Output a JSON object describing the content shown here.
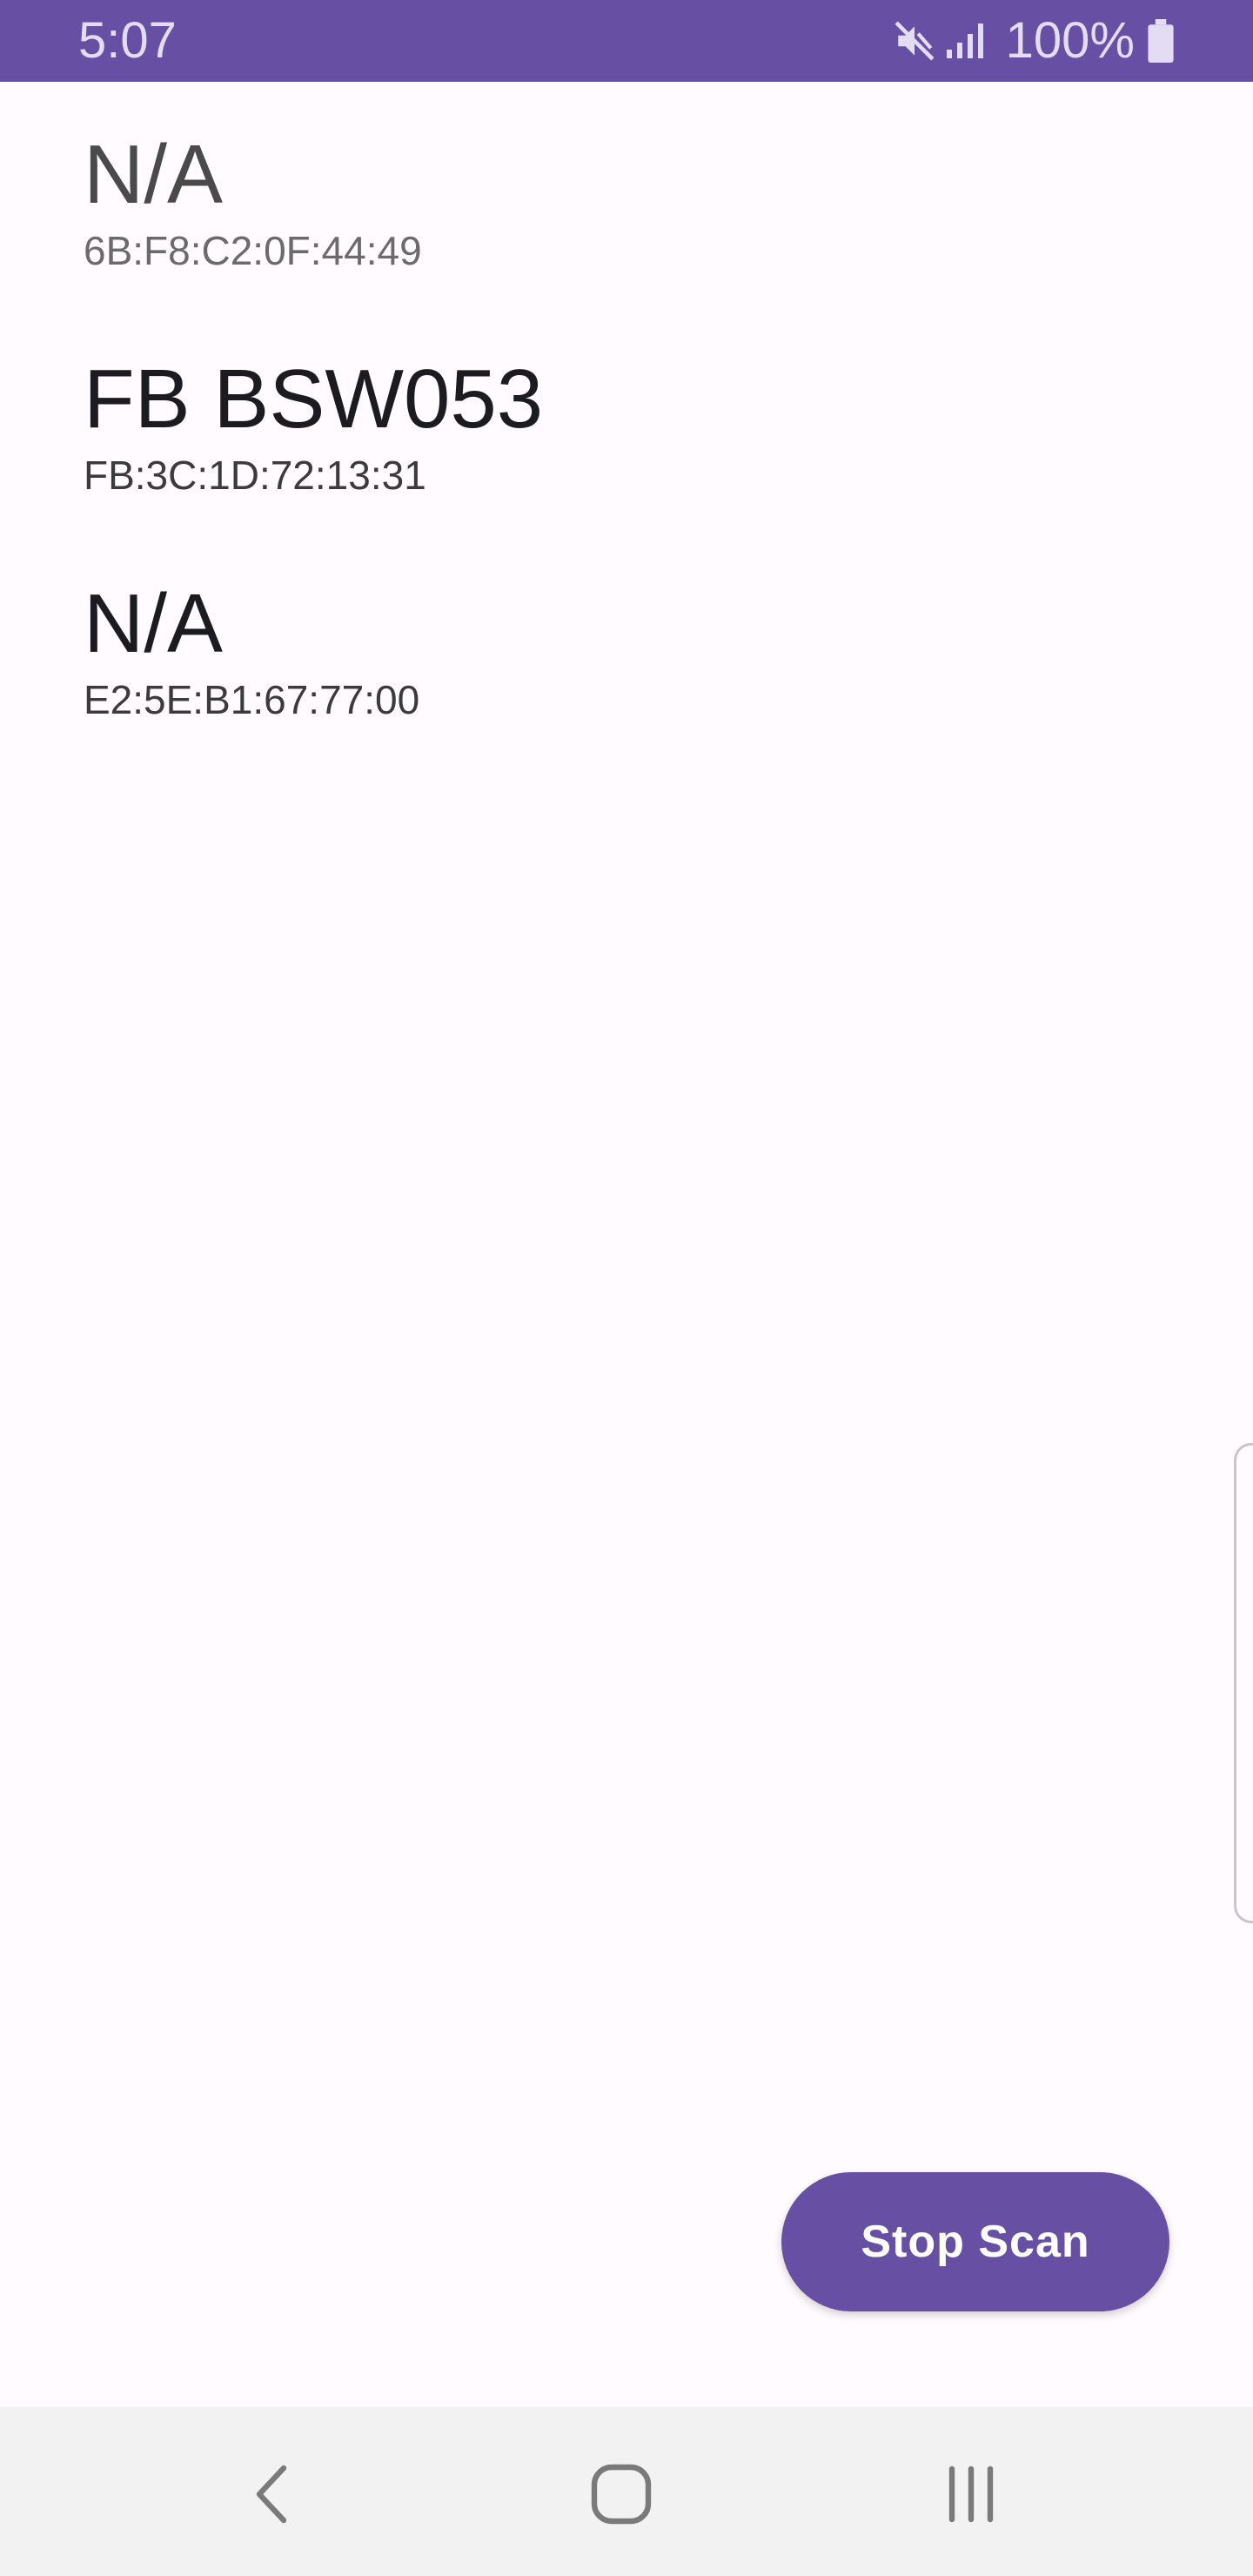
{
  "status_bar": {
    "time": "5:07",
    "battery_text": "100%",
    "icons": [
      "mute-icon",
      "signal-icon",
      "battery-icon"
    ],
    "background_color": "#6750a4"
  },
  "devices": [
    {
      "name": "N/A",
      "address": "6B:F8:C2:0F:44:49"
    },
    {
      "name": "FB BSW053",
      "address": "FB:3C:1D:72:13:31"
    },
    {
      "name": "N/A",
      "address": "E2:5E:B1:67:77:00"
    }
  ],
  "fab": {
    "label": "Stop Scan",
    "color": "#6750a4"
  },
  "nav_bar": {
    "icons": [
      "back-icon",
      "home-icon",
      "recent-apps-icon"
    ]
  }
}
